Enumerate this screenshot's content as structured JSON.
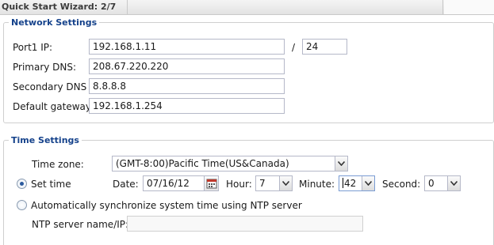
{
  "titlebar": {
    "title": "Quick Start Wizard: 2/7"
  },
  "network": {
    "legend": "Network Settings",
    "port1_label": "Port1 IP:",
    "port1_ip": "192.168.1.11",
    "slash": "/",
    "prefix": "24",
    "primary_dns_label": "Primary DNS:",
    "primary_dns": "208.67.220.220",
    "secondary_dns_label": "Secondary DNS",
    "secondary_dns": "8.8.8.8",
    "gateway_label": "Default gateway:",
    "gateway": "192.168.1.254"
  },
  "time": {
    "legend": "Time Settings",
    "timezone_label": "Time zone:",
    "timezone": "(GMT-8:00)Pacific Time(US&Canada)",
    "set_time_label": "Set time",
    "set_time_selected": true,
    "date_label": "Date:",
    "date": "07/16/12",
    "hour_label": "Hour:",
    "hour": "7",
    "minute_label": "Minute:",
    "minute": "42",
    "second_label": "Second:",
    "second": "0",
    "ntp_option_label": "Automatically synchronize system time using NTP server",
    "ntp_server_label": "NTP server name/IP:",
    "ntp_server": ""
  },
  "icons": {
    "dropdown": "chevron-down-icon",
    "date_picker": "calendar-icon"
  },
  "colors": {
    "legend": "#15428b",
    "border": "#b5b8c8",
    "radio_dot": "#2b5a9e"
  }
}
